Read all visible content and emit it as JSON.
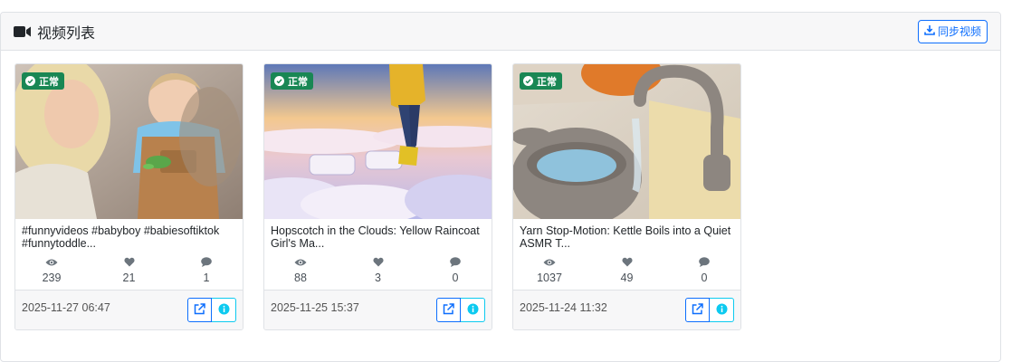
{
  "header": {
    "title": "视频列表",
    "sync_label": "同步视频"
  },
  "colors": {
    "primary": "#0d6efd",
    "success": "#198754",
    "info": "#0dcaf0",
    "stat_icon": "#6c757d"
  },
  "videos": [
    {
      "status": "正常",
      "title": "#funnyvideos #babyboy #babiesoftiktok #funnytoddle...",
      "views": "239",
      "likes": "21",
      "comments": "1",
      "date": "2025-11-27 06:47"
    },
    {
      "status": "正常",
      "title": "Hopscotch in the Clouds: Yellow Raincoat Girl's Ma...",
      "views": "88",
      "likes": "3",
      "comments": "0",
      "date": "2025-11-25 15:37"
    },
    {
      "status": "正常",
      "title": "Yarn Stop-Motion: Kettle Boils into a Quiet ASMR T...",
      "views": "1037",
      "likes": "49",
      "comments": "0",
      "date": "2025-11-24 11:32"
    }
  ],
  "icons": {
    "header": "video-camera-icon",
    "sync": "download-icon",
    "status": "check-circle-icon",
    "views": "eye-icon",
    "likes": "heart-icon",
    "comments": "comment-icon",
    "open": "external-link-icon",
    "info": "info-circle-icon"
  }
}
